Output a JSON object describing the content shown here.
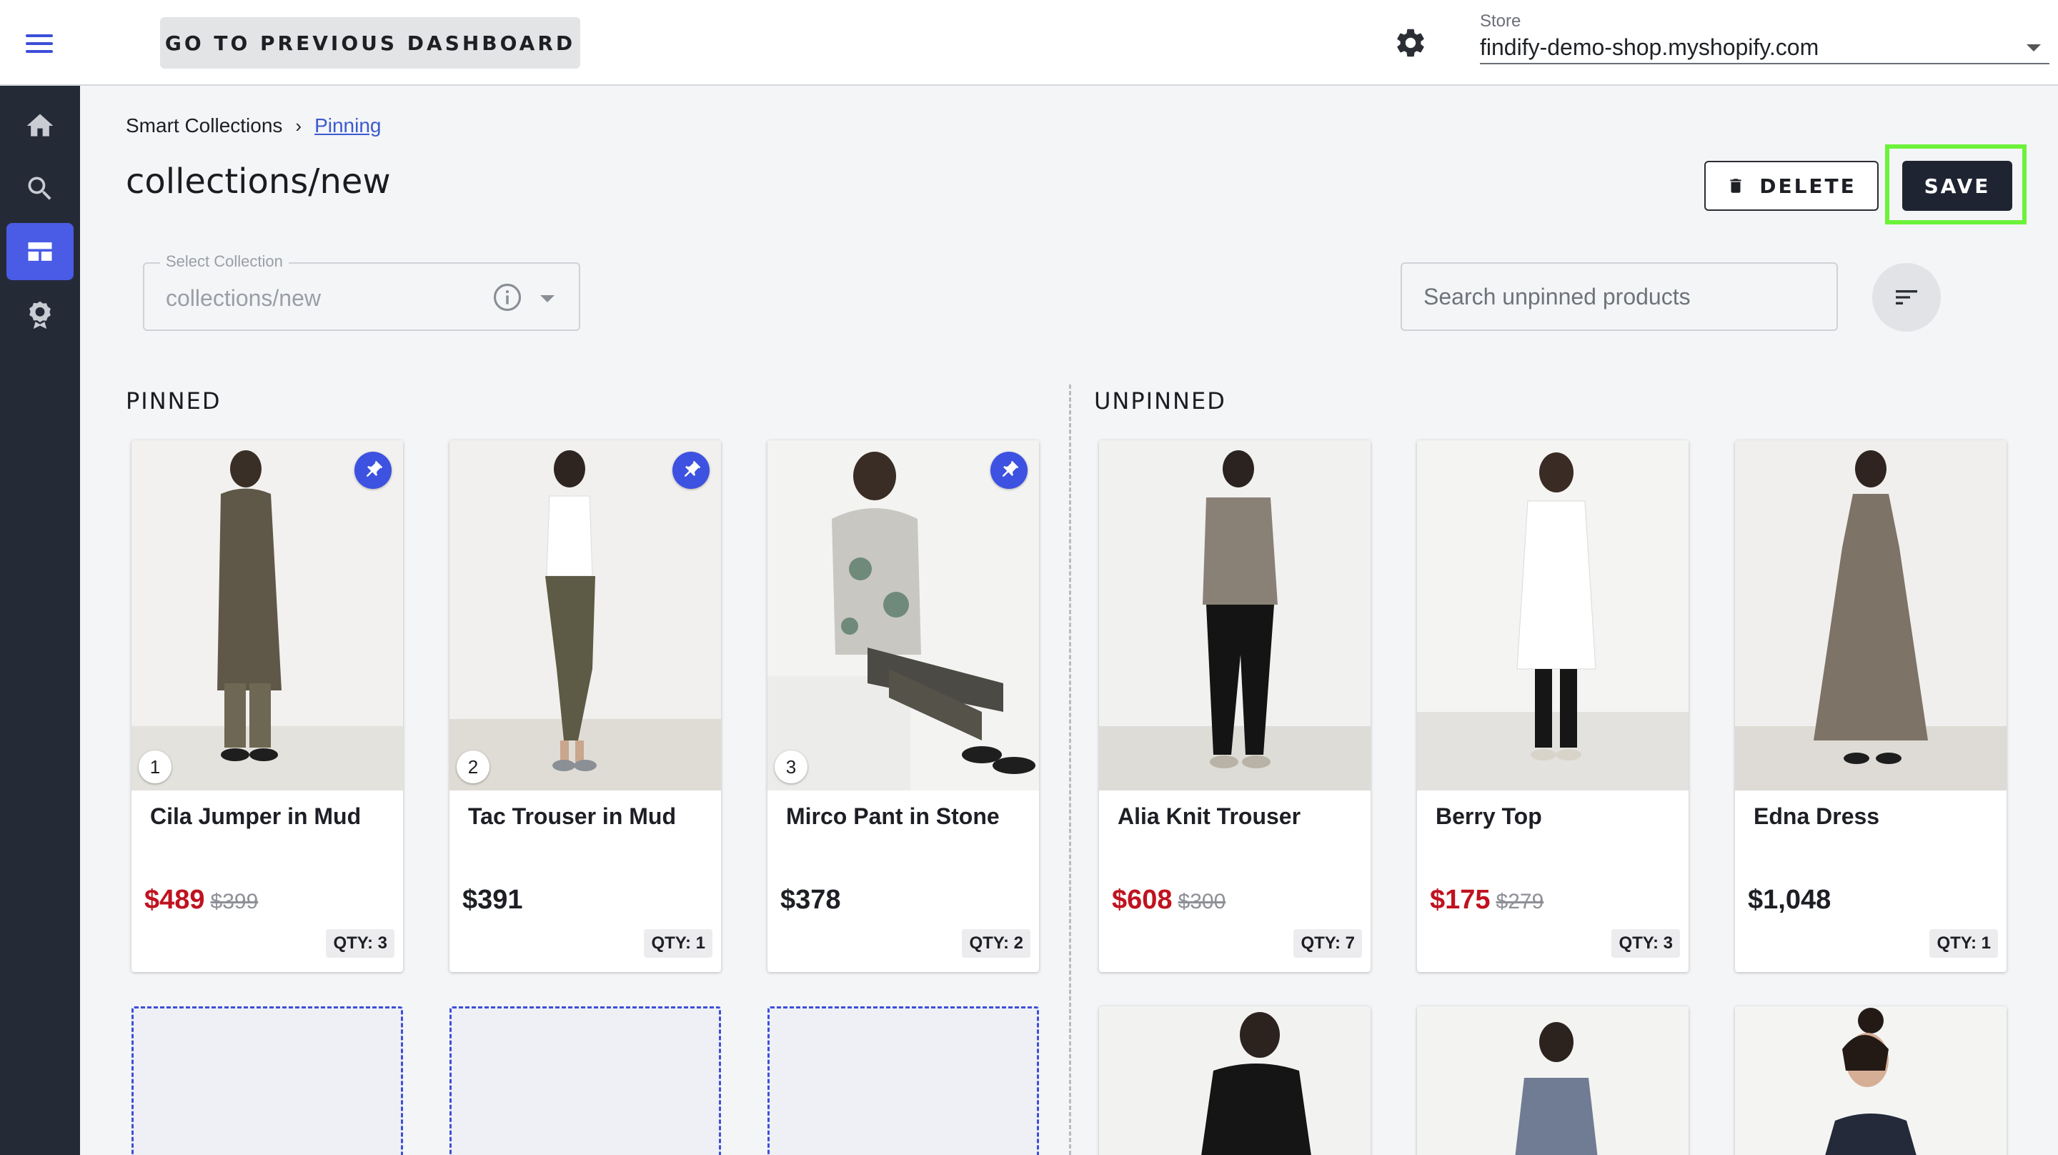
{
  "header": {
    "prev_dashboard_label": "GO TO PREVIOUS DASHBOARD",
    "store_label": "Store",
    "store_value": "findify-demo-shop.myshopify.com"
  },
  "sidebar": {
    "items": [
      {
        "name": "home-icon"
      },
      {
        "name": "search-icon"
      },
      {
        "name": "dashboard-icon",
        "active": true
      },
      {
        "name": "badge-icon"
      }
    ]
  },
  "breadcrumb": {
    "root": "Smart Collections",
    "separator": "›",
    "current": "Pinning"
  },
  "page": {
    "title": "collections/new",
    "delete_label": "DELETE",
    "save_label": "SAVE"
  },
  "select_collection": {
    "legend": "Select Collection",
    "value": "collections/new"
  },
  "search": {
    "placeholder": "Search unpinned products"
  },
  "sections": {
    "pinned": "PINNED",
    "unpinned": "UNPINNED"
  },
  "pinned_products": [
    {
      "position": "1",
      "name": "Cila Jumper in Mud",
      "price": "$489",
      "compare_price": "$399",
      "on_sale": true,
      "qty": "QTY: 3"
    },
    {
      "position": "2",
      "name": "Tac Trouser in Mud",
      "price": "$391",
      "compare_price": "",
      "on_sale": false,
      "qty": "QTY: 1"
    },
    {
      "position": "3",
      "name": "Mirco Pant in Stone",
      "price": "$378",
      "compare_price": "",
      "on_sale": false,
      "qty": "QTY: 2"
    }
  ],
  "unpinned_products": [
    {
      "name": "Alia Knit Trouser",
      "price": "$608",
      "compare_price": "$300",
      "on_sale": true,
      "qty": "QTY: 7"
    },
    {
      "name": "Berry Top",
      "price": "$175",
      "compare_price": "$279",
      "on_sale": true,
      "qty": "QTY: 3"
    },
    {
      "name": "Edna Dress",
      "price": "$1,048",
      "compare_price": "",
      "on_sale": false,
      "qty": "QTY: 1"
    }
  ],
  "colors": {
    "accent": "#3d52e0",
    "sidebar_bg": "#252a37",
    "sale_price": "#c0121f",
    "save_highlight": "#6cf23a"
  }
}
